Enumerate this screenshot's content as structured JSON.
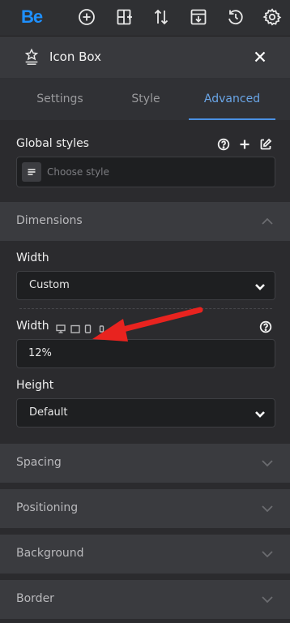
{
  "topbar": {
    "logo": "Be",
    "icons": [
      "add-circle-icon",
      "layout-add-icon",
      "sort-arrows-icon",
      "save-download-icon",
      "history-icon",
      "gear-icon"
    ]
  },
  "panel": {
    "icon": "icon-box-icon",
    "title": "Icon Box",
    "close_icon": "close-icon"
  },
  "tabs": [
    {
      "label": "Settings",
      "active": false
    },
    {
      "label": "Style",
      "active": false
    },
    {
      "label": "Advanced",
      "active": true
    }
  ],
  "global_styles": {
    "label": "Global styles",
    "placeholder": "Choose style"
  },
  "dimensions": {
    "title": "Dimensions",
    "width_mode_label": "Width",
    "width_mode_value": "Custom",
    "width_value_label": "Width",
    "width_value": "12%",
    "height_label": "Height",
    "height_value": "Default"
  },
  "accordions": [
    "Spacing",
    "Positioning",
    "Background",
    "Border"
  ],
  "colors": {
    "accent": "#4a90e2",
    "logo": "#1e90ff",
    "annotation_arrow": "#e8231f"
  }
}
